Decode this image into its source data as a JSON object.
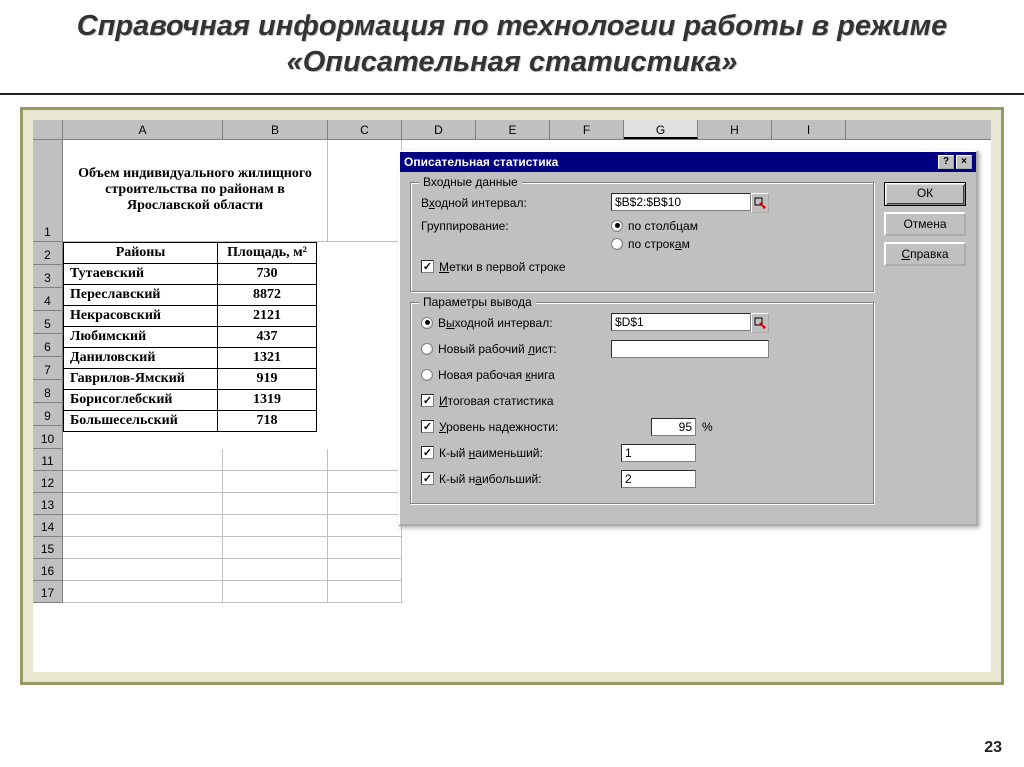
{
  "slide": {
    "title": "Справочная информация по технологии работы в режиме «Описательная статистика»",
    "page_number": "23"
  },
  "sheet": {
    "columns": [
      "A",
      "B",
      "C",
      "D",
      "E",
      "F",
      "G",
      "H",
      "I"
    ],
    "active_col": "G",
    "table_title": "Объем индивидуального жилищного строительства по районам в Ярославской области",
    "header_row": {
      "col1": "Районы",
      "col2": "Площадь, м²"
    },
    "rows": [
      {
        "num": "2"
      },
      {
        "num": "3",
        "name": "Тутаевский",
        "val": "730"
      },
      {
        "num": "4",
        "name": "Переславский",
        "val": "8872"
      },
      {
        "num": "5",
        "name": "Некрасовский",
        "val": "2121"
      },
      {
        "num": "6",
        "name": "Любимский",
        "val": "437"
      },
      {
        "num": "7",
        "name": "Даниловский",
        "val": "1321"
      },
      {
        "num": "8",
        "name": "Гаврилов-Ямский",
        "val": "919"
      },
      {
        "num": "9",
        "name": "Борисоглебский",
        "val": "1319"
      },
      {
        "num": "10",
        "name": "Большесельский",
        "val": "718"
      }
    ],
    "empty_rows": [
      "11",
      "12",
      "13",
      "14",
      "15",
      "16",
      "17"
    ]
  },
  "dialog": {
    "title": "Описательная статистика",
    "buttons": {
      "ok": "ОК",
      "cancel": "Отмена",
      "help": "Справка"
    },
    "group_input": {
      "title": "Входные данные",
      "input_range_label": "Входной интервал:",
      "input_range_value": "$B$2:$B$10",
      "grouping_label": "Группирование:",
      "by_cols": "по столбцам",
      "by_rows": "по строкам",
      "labels_first_row": "Метки в первой строке"
    },
    "group_output": {
      "title": "Параметры вывода",
      "out_range_label": "Выходной интервал:",
      "out_range_value": "$D$1",
      "new_sheet_label": "Новый рабочий лист:",
      "new_book_label": "Новая рабочая книга",
      "summary_label": "Итоговая статистика",
      "confidence_label": "Уровень надежности:",
      "confidence_value": "95",
      "confidence_pct": "%",
      "kth_smallest_label": "К-ый наименьший:",
      "kth_smallest_value": "1",
      "kth_largest_label": "К-ый наибольший:",
      "kth_largest_value": "2"
    }
  }
}
